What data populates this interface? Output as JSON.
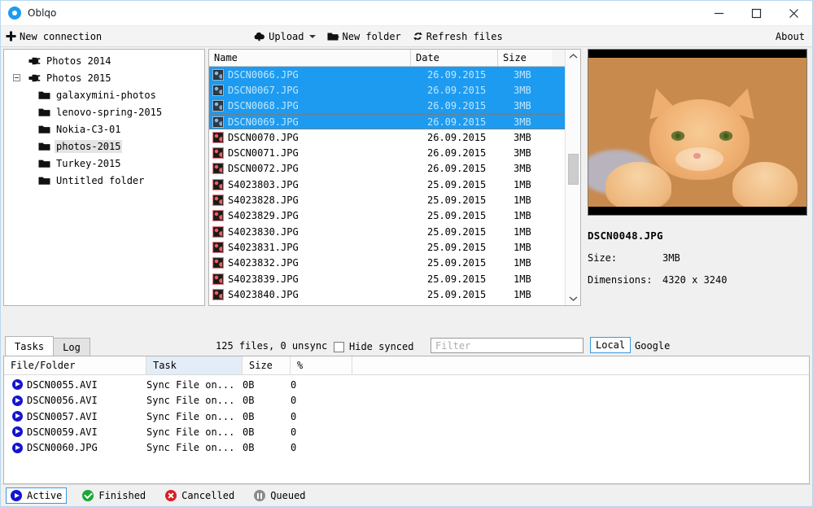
{
  "window": {
    "title": "Oblqo",
    "app_icon": "circle-logo-icon",
    "minimize_label": "—",
    "maximize_label": "□",
    "close_label": "✕"
  },
  "toolbar": {
    "new_connection": "New connection",
    "upload": "Upload",
    "new_folder": "New folder",
    "refresh_files": "Refresh files",
    "about": "About"
  },
  "tree": {
    "items": [
      {
        "label": "Photos 2014",
        "icon": "plug-icon",
        "depth": 0,
        "expander": "",
        "selected": false
      },
      {
        "label": "Photos 2015",
        "icon": "plug-icon",
        "depth": 0,
        "expander": "minus",
        "selected": false
      },
      {
        "label": "galaxymini-photos",
        "icon": "folder-icon",
        "depth": 1,
        "expander": "",
        "selected": false
      },
      {
        "label": "lenovo-spring-2015",
        "icon": "folder-icon",
        "depth": 1,
        "expander": "",
        "selected": false
      },
      {
        "label": "Nokia-C3-01",
        "icon": "folder-icon",
        "depth": 1,
        "expander": "",
        "selected": false
      },
      {
        "label": "photos-2015",
        "icon": "folder-icon",
        "depth": 1,
        "expander": "",
        "selected": true
      },
      {
        "label": "Turkey-2015",
        "icon": "folder-icon",
        "depth": 1,
        "expander": "",
        "selected": false
      },
      {
        "label": "Untitled folder",
        "icon": "folder-icon",
        "depth": 1,
        "expander": "",
        "selected": false
      }
    ]
  },
  "file_list": {
    "columns": {
      "name": "Name",
      "date": "Date",
      "size": "Size"
    },
    "rows": [
      {
        "name": "DSCN0066.JPG",
        "date": "26.09.2015",
        "size": "3MB",
        "selected": true,
        "focused": false
      },
      {
        "name": "DSCN0067.JPG",
        "date": "26.09.2015",
        "size": "3MB",
        "selected": true,
        "focused": false
      },
      {
        "name": "DSCN0068.JPG",
        "date": "26.09.2015",
        "size": "3MB",
        "selected": true,
        "focused": false
      },
      {
        "name": "DSCN0069.JPG",
        "date": "26.09.2015",
        "size": "3MB",
        "selected": true,
        "focused": true
      },
      {
        "name": "DSCN0070.JPG",
        "date": "26.09.2015",
        "size": "3MB",
        "selected": false,
        "focused": false
      },
      {
        "name": "DSCN0071.JPG",
        "date": "26.09.2015",
        "size": "3MB",
        "selected": false,
        "focused": false
      },
      {
        "name": "DSCN0072.JPG",
        "date": "26.09.2015",
        "size": "3MB",
        "selected": false,
        "focused": false
      },
      {
        "name": "S4023803.JPG",
        "date": "25.09.2015",
        "size": "1MB",
        "selected": false,
        "focused": false
      },
      {
        "name": "S4023828.JPG",
        "date": "25.09.2015",
        "size": "1MB",
        "selected": false,
        "focused": false
      },
      {
        "name": "S4023829.JPG",
        "date": "25.09.2015",
        "size": "1MB",
        "selected": false,
        "focused": false
      },
      {
        "name": "S4023830.JPG",
        "date": "25.09.2015",
        "size": "1MB",
        "selected": false,
        "focused": false
      },
      {
        "name": "S4023831.JPG",
        "date": "25.09.2015",
        "size": "1MB",
        "selected": false,
        "focused": false
      },
      {
        "name": "S4023832.JPG",
        "date": "25.09.2015",
        "size": "1MB",
        "selected": false,
        "focused": false
      },
      {
        "name": "S4023839.JPG",
        "date": "25.09.2015",
        "size": "1MB",
        "selected": false,
        "focused": false
      },
      {
        "name": "S4023840.JPG",
        "date": "25.09.2015",
        "size": "1MB",
        "selected": false,
        "focused": false
      }
    ]
  },
  "preview": {
    "image_alt": "orange-cat-photo",
    "filename": "DSCN0048.JPG",
    "size_label": "Size:",
    "size_value": "3MB",
    "dimensions_label": "Dimensions:",
    "dimensions_value": "4320 x 3240"
  },
  "midbar": {
    "tabs": [
      {
        "label": "Tasks",
        "active": true
      },
      {
        "label": "Log",
        "active": false
      }
    ],
    "status": "125 files, 0 unsync",
    "hide_synced": "Hide synced",
    "hide_synced_checked": false,
    "filter_placeholder": "Filter",
    "filter_value": "",
    "source_local": "Local",
    "source_google": "Google",
    "source_selected": "Local"
  },
  "tasks": {
    "columns": {
      "file": "File/Folder",
      "task": "Task",
      "size": "Size",
      "pct": "%"
    },
    "sorted_column": "Task",
    "rows": [
      {
        "file": "DSCN0055.AVI",
        "task": "Sync File on...",
        "size": "0B",
        "pct": "0",
        "state": "active"
      },
      {
        "file": "DSCN0056.AVI",
        "task": "Sync File on...",
        "size": "0B",
        "pct": "0",
        "state": "active"
      },
      {
        "file": "DSCN0057.AVI",
        "task": "Sync File on...",
        "size": "0B",
        "pct": "0",
        "state": "active"
      },
      {
        "file": "DSCN0059.AVI",
        "task": "Sync File on...",
        "size": "0B",
        "pct": "0",
        "state": "active"
      },
      {
        "file": "DSCN0060.JPG",
        "task": "Sync File on...",
        "size": "0B",
        "pct": "0",
        "state": "active"
      }
    ]
  },
  "statusbar": {
    "filters": [
      {
        "label": "Active",
        "icon": "play-circle-icon",
        "color": "#1414cf",
        "selected": true
      },
      {
        "label": "Finished",
        "icon": "check-circle-icon",
        "color": "#19a832",
        "selected": false
      },
      {
        "label": "Cancelled",
        "icon": "x-circle-icon",
        "color": "#d81f26",
        "selected": false
      },
      {
        "label": "Queued",
        "icon": "pause-circle-icon",
        "color": "#8b8b8b",
        "selected": false
      }
    ]
  },
  "colors": {
    "accent": "#1d9bf0",
    "selection": "#1d9bf0",
    "selection_text": "#bfe6ff",
    "window_bg": "#f0f0f0"
  }
}
